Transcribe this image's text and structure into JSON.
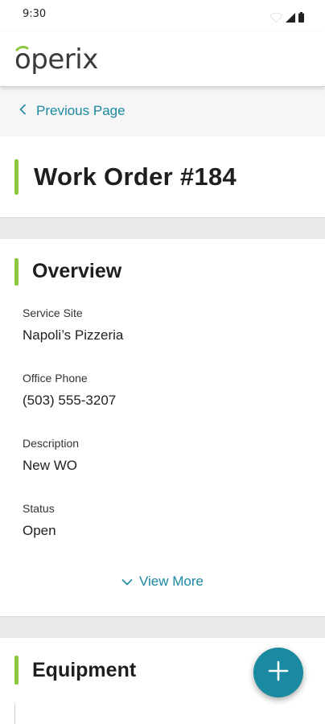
{
  "status_bar": {
    "time": "9:30",
    "icons": [
      "wifi-icon",
      "cellular-signal-icon",
      "battery-icon"
    ]
  },
  "header": {
    "logo_text": "operix",
    "accent_color": "#8dc63f"
  },
  "nav": {
    "back_label": "Previous Page",
    "back_icon": "chevron-left-icon",
    "link_color": "#1a8aa0"
  },
  "page": {
    "title": "Work Order #184"
  },
  "overview": {
    "title": "Overview",
    "fields": [
      {
        "label": "Service Site",
        "value": "Napoli’s Pizzeria"
      },
      {
        "label": "Office Phone",
        "value": "(503) 555-3207"
      },
      {
        "label": "Description",
        "value": "New WO"
      },
      {
        "label": "Status",
        "value": "Open"
      }
    ],
    "view_more_label": "View More",
    "view_more_icon": "chevron-down-icon"
  },
  "equipment": {
    "title": "Equipment"
  },
  "fab": {
    "icon": "plus-icon",
    "color": "#1a8aa0"
  }
}
